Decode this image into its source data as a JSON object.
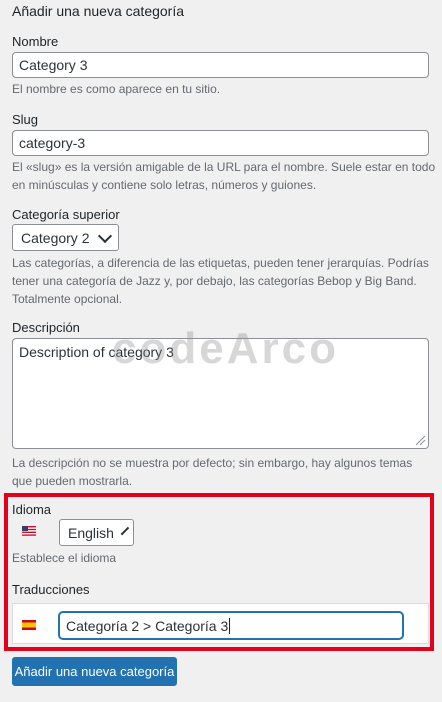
{
  "form": {
    "title": "Añadir una nueva categoría",
    "name": {
      "label": "Nombre",
      "value": "Category 3",
      "hint": "El nombre es como aparece en tu sitio."
    },
    "slug": {
      "label": "Slug",
      "value": "category-3",
      "hint_line1": "El «slug» es la versión amigable de la URL para el nombre. Suele estar en todo",
      "hint_line2": "en minúsculas y contiene solo letras, números y guiones."
    },
    "parent": {
      "label": "Categoría superior",
      "selected": "Category 2",
      "hint_line1": "Las categorías, a diferencia de las etiquetas, pueden tener jerarquías. Podrías",
      "hint_line2": "tener una categoría de Jazz y, por debajo, las categorías Bebop y Big Band.",
      "hint_line3": "Totalmente opcional."
    },
    "description": {
      "label": "Descripción",
      "value": "Description of category 3",
      "hint_line1": "La descripción no se muestra por defecto; sin embargo, hay algunos temas",
      "hint_line2": "que pueden mostrarla."
    },
    "language": {
      "label": "Idioma",
      "selected": "English",
      "hint": "Establece el idioma",
      "flag_icon": "us-flag-icon"
    },
    "translations": {
      "label": "Traducciones",
      "value": "Categoría 2 > Categoría 3",
      "flag_icon": "es-flag-icon"
    },
    "submit_label": "Añadir una nueva categoría"
  },
  "watermark": "codeArco",
  "colors": {
    "accent": "#2271b1",
    "highlight_box": "#e3001b",
    "background": "#f0f0f1"
  }
}
